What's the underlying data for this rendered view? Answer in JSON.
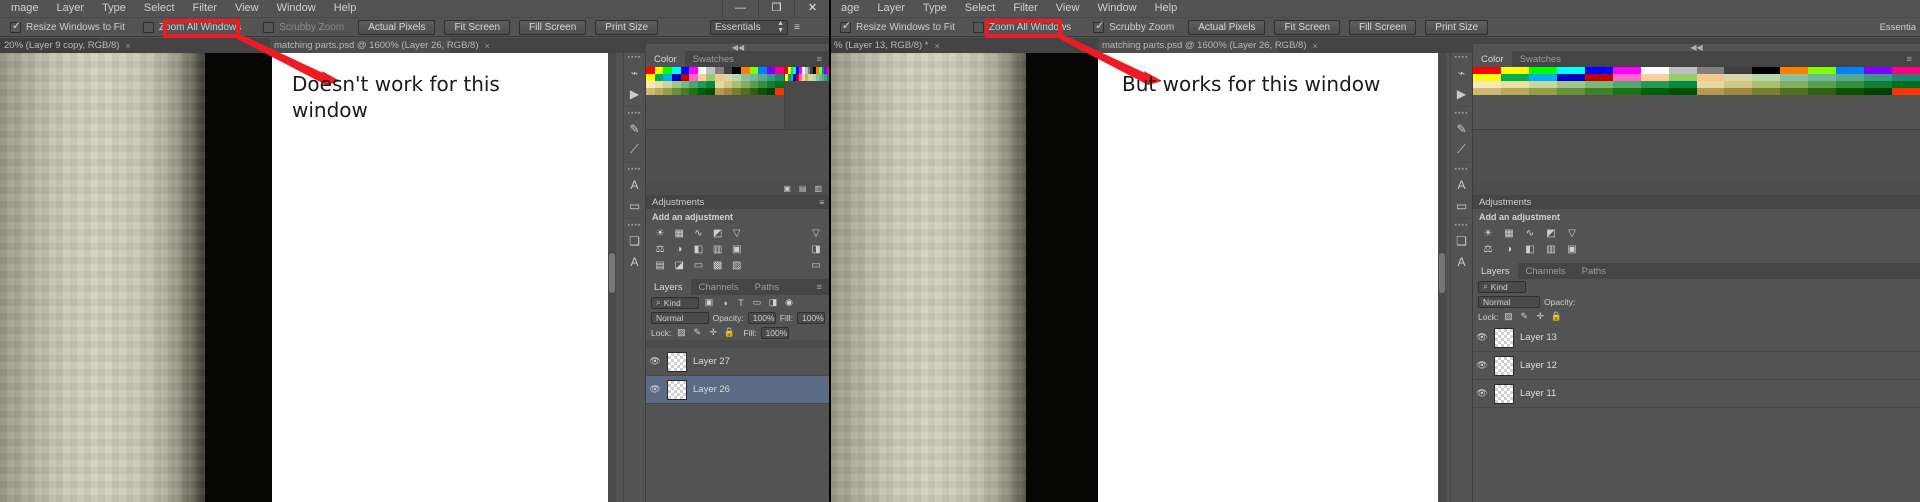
{
  "app": {
    "menus": [
      "mage",
      "Layer",
      "Type",
      "Select",
      "Filter",
      "View",
      "Window",
      "Help"
    ],
    "menus_right": [
      "age",
      "Layer",
      "Type",
      "Select",
      "Filter",
      "View",
      "Window",
      "Help"
    ],
    "window_controls": [
      "—",
      "❐",
      "✕"
    ],
    "window_controls_extra": [
      "❐",
      "✕"
    ]
  },
  "option_bar": {
    "resize_label": "Resize Windows to Fit",
    "zoom_all_label": "Zoom All Windows",
    "scrubby_label": "Scrubby Zoom",
    "buttons": [
      "Actual Pixels",
      "Fit Screen",
      "Fill Screen",
      "Print Size"
    ],
    "workspace": "Essentials",
    "workspace_right": "Essentia"
  },
  "left_window": {
    "tab_active": "20% (Layer 9 copy, RGB/8)",
    "tab_other": "matching parts.psd @ 1600% (Layer 26, RGB/8)",
    "scrubby_checked": false,
    "resize_checked": true,
    "zoom_all_checked": false,
    "annotation": "Doesn't work for this window"
  },
  "right_window": {
    "tab_active": "% (Layer 13, RGB/8) *",
    "tab_other": "matching parts.psd @ 1600% (Layer 26, RGB/8)",
    "scrubby_checked": true,
    "resize_checked": true,
    "zoom_all_checked": false,
    "annotation": "But works for this window"
  },
  "panels": {
    "color_tab": "Color",
    "swatches_tab": "Swatches",
    "adjustments_title": "Adjustments",
    "add_adjustment": "Add an adjustment",
    "layers_tabs": [
      "Layers",
      "Channels",
      "Paths"
    ],
    "kind_label": "Kind",
    "blend_mode": "Normal",
    "opacity_label": "Opacity:",
    "opacity_value": "100%",
    "fill_label": "Fill:",
    "fill_value": "100%",
    "lock_label": "Lock:",
    "layers_left": [
      {
        "name": "Layer 27",
        "selected": false
      },
      {
        "name": "Layer 26",
        "selected": true
      }
    ],
    "layers_right": [
      {
        "name": "Layer 13",
        "selected": false
      },
      {
        "name": "Layer 12",
        "selected": false
      },
      {
        "name": "Layer 11",
        "selected": false
      }
    ]
  },
  "colors": {
    "annotation_red": "#ed1c24",
    "selection_blue": "#5b6b86",
    "chrome": "#535353"
  },
  "swatch_palette": [
    "#ff0000",
    "#ffff00",
    "#00ff00",
    "#00ffff",
    "#0000ff",
    "#ff00ff",
    "#ffffff",
    "#c0c0c0",
    "#808080",
    "#404040",
    "#000000",
    "#ff8000",
    "#80ff00",
    "#0080ff",
    "#8000ff",
    "#ff0080",
    "#ffff00",
    "#00b050",
    "#00b0f0",
    "#0000c0",
    "#c00000",
    "#ff66cc",
    "#ffcc99",
    "#99cc66",
    "#f0c890",
    "#d8d8a8",
    "#b8d8a8",
    "#88c0a0",
    "#70b898",
    "#58a890",
    "#3c9880",
    "#208870",
    "#f8e8b8",
    "#e8e0a0",
    "#c8d898",
    "#a0c888",
    "#78b878",
    "#50a868",
    "#289858",
    "#088848",
    "#e8d8a0",
    "#d0c888",
    "#a8c070",
    "#80b060",
    "#58a050",
    "#309040",
    "#108030",
    "#007020",
    "#d0b870",
    "#b8a858",
    "#90a048",
    "#689038",
    "#408028",
    "#207018",
    "#006008",
    "#005000",
    "#b89850",
    "#a08840",
    "#788030",
    "#507020",
    "#306010",
    "#105000",
    "#004000",
    "#ff3300"
  ]
}
